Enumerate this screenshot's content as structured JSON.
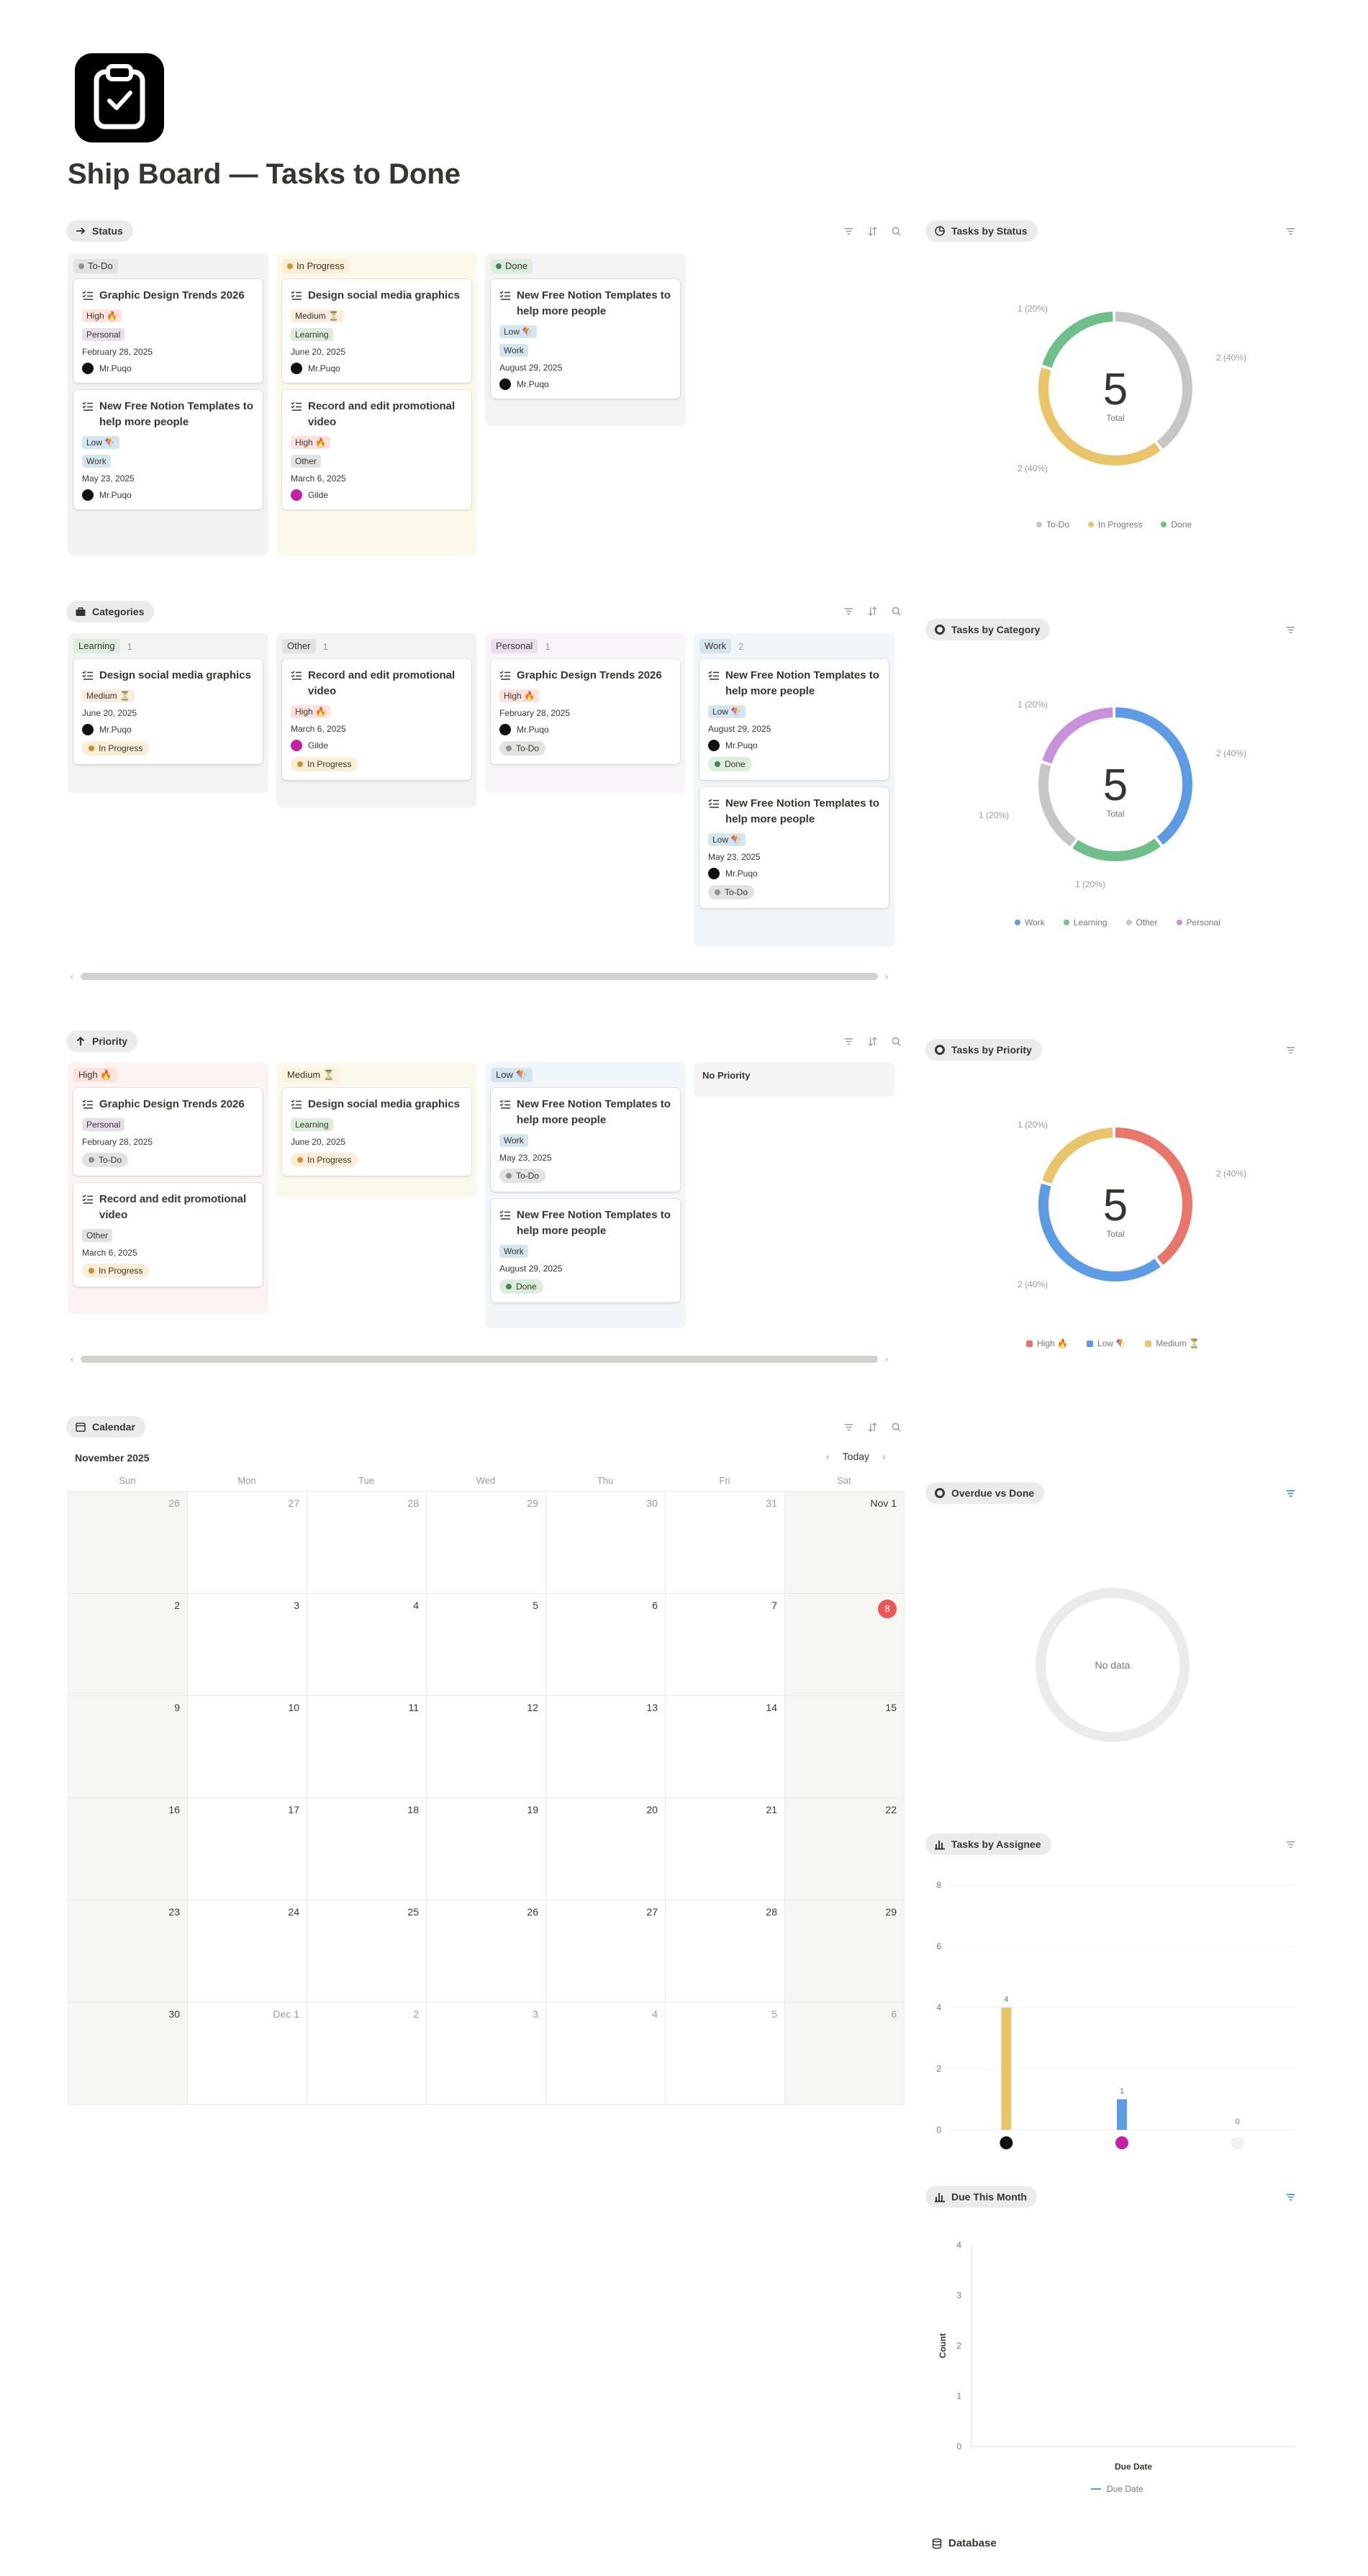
{
  "page": {
    "title": "Ship Board — Tasks to Done"
  },
  "status_board": {
    "chip": "Status",
    "columns": [
      {
        "label": "To-Do",
        "color": "#9b9a97",
        "cards": [
          {
            "title": "Graphic Design Trends 2026",
            "priority": "High 🔥",
            "category": "Personal",
            "date": "February 28, 2025",
            "person": "Mr.Puqo"
          },
          {
            "title": "New Free Notion Templates to help more people",
            "priority": "Low 🪁",
            "category": "Work",
            "date": "May 23, 2025",
            "person": "Mr.Puqo"
          }
        ]
      },
      {
        "label": "In Progress",
        "color": "#e9b949",
        "cards": [
          {
            "title": "Design social media graphics",
            "priority": "Medium ⏳",
            "category": "Learning",
            "date": "June 20, 2025",
            "person": "Mr.Puqo"
          },
          {
            "title": "Record and edit promotional video",
            "priority": "High 🔥",
            "category": "Other",
            "date": "March 6, 2025",
            "person": "Gilde"
          }
        ]
      },
      {
        "label": "Done",
        "color": "#4dab9a",
        "cards": [
          {
            "title": "New Free Notion Templates to help more people",
            "priority": "Low 🪁",
            "category": "Work",
            "date": "August 29, 2025",
            "person": "Mr.Puqo"
          }
        ]
      }
    ]
  },
  "status_chart": {
    "chip": "Tasks by Status",
    "total": "5",
    "total_label": "Total",
    "labels": [
      "1 (20%)",
      "2 (40%)",
      "2 (40%)"
    ],
    "legend": [
      "To-Do",
      "In Progress",
      "Done"
    ]
  },
  "categories_board": {
    "chip": "Categories",
    "columns": [
      {
        "label": "Learning",
        "count": "1",
        "cards": [
          {
            "title": "Design social media graphics",
            "priority": "Medium ⏳",
            "date": "June 20, 2025",
            "person": "Mr.Puqo",
            "status": "In Progress"
          }
        ]
      },
      {
        "label": "Other",
        "count": "1",
        "cards": [
          {
            "title": "Record and edit promotional video",
            "priority": "High 🔥",
            "date": "March 6, 2025",
            "person": "Gilde",
            "status": "In Progress"
          }
        ]
      },
      {
        "label": "Personal",
        "count": "1",
        "cards": [
          {
            "title": "Graphic Design Trends 2026",
            "priority": "High 🔥",
            "date": "February 28, 2025",
            "person": "Mr.Puqo",
            "status": "To-Do"
          }
        ]
      },
      {
        "label": "Work",
        "count": "2",
        "cards": [
          {
            "title": "New Free Notion Templates to help more people",
            "priority": "Low 🪁",
            "date": "August 29, 2025",
            "person": "Mr.Puqo",
            "status": "Done"
          },
          {
            "title": "New Free Notion Templates to help more people",
            "priority": "Low 🪁",
            "date": "May 23, 2025",
            "person": "Mr.Puqo",
            "status": "To-Do"
          }
        ]
      }
    ]
  },
  "category_chart": {
    "chip": "Tasks by Category",
    "total": "5",
    "total_label": "Total",
    "labels": [
      "1 (20%)",
      "2 (40%)",
      "1 (20%)",
      "1 (20%)"
    ],
    "legend": [
      "Work",
      "Learning",
      "Other",
      "Personal"
    ]
  },
  "priority_board": {
    "chip": "Priority",
    "columns": [
      {
        "label": "High 🔥",
        "cards": [
          {
            "title": "Graphic Design Trends 2026",
            "category": "Personal",
            "date": "February 28, 2025",
            "status": "To-Do"
          },
          {
            "title": "Record and edit promotional video",
            "category": "Other",
            "date": "March 6, 2025",
            "status": "In Progress"
          }
        ]
      },
      {
        "label": "Medium ⏳",
        "cards": [
          {
            "title": "Design social media graphics",
            "category": "Learning",
            "date": "June 20, 2025",
            "status": "In Progress"
          }
        ]
      },
      {
        "label": "Low 🪁",
        "cards": [
          {
            "title": "New Free Notion Templates to help more people",
            "category": "Work",
            "date": "May 23, 2025",
            "status": "To-Do"
          },
          {
            "title": "New Free Notion Templates to help more people",
            "category": "Work",
            "date": "August 29, 2025",
            "status": "Done"
          }
        ]
      },
      {
        "label": "No Priority",
        "cards": []
      }
    ]
  },
  "priority_chart": {
    "chip": "Tasks by Priority",
    "total": "5",
    "total_label": "Total",
    "labels": [
      "1 (20%)",
      "2 (40%)",
      "2 (40%)"
    ],
    "legend": [
      "High 🔥",
      "Low 🪁",
      "Medium ⏳"
    ]
  },
  "calendar": {
    "chip": "Calendar",
    "month": "November 2025",
    "today_label": "Today",
    "weekdays": [
      "Sun",
      "Mon",
      "Tue",
      "Wed",
      "Thu",
      "Fri",
      "Sat"
    ],
    "weeks": [
      [
        "26",
        "27",
        "28",
        "29",
        "30",
        "31",
        "Nov 1"
      ],
      [
        "2",
        "3",
        "4",
        "5",
        "6",
        "7",
        "8"
      ],
      [
        "9",
        "10",
        "11",
        "12",
        "13",
        "14",
        "15"
      ],
      [
        "16",
        "17",
        "18",
        "19",
        "20",
        "21",
        "22"
      ],
      [
        "23",
        "24",
        "25",
        "26",
        "27",
        "28",
        "29"
      ],
      [
        "30",
        "Dec 1",
        "2",
        "3",
        "4",
        "5",
        "6"
      ]
    ]
  },
  "overdue_chart": {
    "chip": "Overdue vs Done",
    "empty": "No data"
  },
  "assignee_chart": {
    "chip": "Tasks by Assignee",
    "y_ticks": [
      "8",
      "6",
      "4",
      "2",
      "0"
    ],
    "value_labels": [
      "4",
      "1",
      "0"
    ]
  },
  "due_chart": {
    "chip": "Due This Month",
    "y_ticks": [
      "4",
      "3",
      "2",
      "1",
      "0"
    ],
    "ylabel": "Count",
    "xlabel": "Due Date",
    "legend": "Due Date"
  },
  "database": {
    "label": "Database"
  },
  "colors": {
    "todo": "#c7c6c4",
    "in_progress": "#e9c46a",
    "done": "#6fbf8a",
    "work": "#5d9be4",
    "personal": "#c892da",
    "high": "#e8766b",
    "accent": "#2383e2"
  },
  "chart_data": [
    {
      "type": "pie",
      "title": "Tasks by Status",
      "categories": [
        "To-Do",
        "In Progress",
        "Done"
      ],
      "values": [
        2,
        2,
        1
      ]
    },
    {
      "type": "pie",
      "title": "Tasks by Category",
      "categories": [
        "Work",
        "Learning",
        "Other",
        "Personal"
      ],
      "values": [
        2,
        1,
        1,
        1
      ]
    },
    {
      "type": "pie",
      "title": "Tasks by Priority",
      "categories": [
        "High 🔥",
        "Low 🪁",
        "Medium ⏳"
      ],
      "values": [
        2,
        2,
        1
      ]
    },
    {
      "type": "bar",
      "title": "Tasks by Assignee",
      "categories": [
        "Mr.Puqo",
        "Gilde",
        "(none)"
      ],
      "values": [
        4,
        1,
        0
      ],
      "ylim": [
        0,
        8
      ]
    },
    {
      "type": "line",
      "title": "Due This Month",
      "xlabel": "Due Date",
      "ylabel": "Count",
      "ylim": [
        0,
        4
      ],
      "series": [
        {
          "name": "Due Date",
          "values": []
        }
      ]
    }
  ]
}
